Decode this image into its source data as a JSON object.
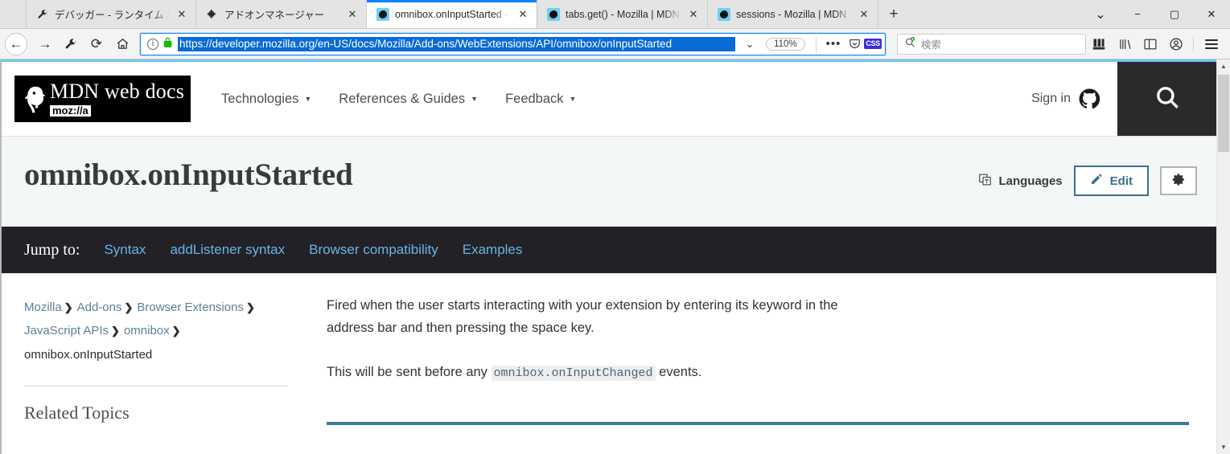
{
  "browser": {
    "tabs": [
      {
        "favicon": "wrench-icon",
        "title": "デバッガー - ランタイム / this-firefox",
        "active": false
      },
      {
        "favicon": "puzzle-icon",
        "title": "アドオンマネージャー",
        "active": false
      },
      {
        "favicon": "firefox-icon",
        "title": "omnibox.onInputStarted - Moz",
        "active": true
      },
      {
        "favicon": "firefox-icon",
        "title": "tabs.get() - Mozilla | MDN",
        "active": false
      },
      {
        "favicon": "firefox-icon",
        "title": "sessions - Mozilla | MDN",
        "active": false
      }
    ],
    "new_tab_label": "+",
    "close_label": "✕",
    "tab_list_label": "⌄",
    "window_controls": {
      "minimize": "−",
      "maximize": "▢",
      "close": "✕"
    },
    "nav": {
      "back_label": "←",
      "forward_label": "→",
      "devtools_label": "🔧",
      "reload_label": "⟳",
      "home_label": "⌂"
    },
    "urlbar": {
      "info_label": "i",
      "lock_label": "lock-icon",
      "url": "https://developer.mozilla.org/en-US/docs/Mozilla/Add-ons/WebExtensions/API/omnibox/onInputStarted",
      "dropdown_label": "⌄",
      "zoom_level": "110%",
      "page_actions_label": "•••",
      "pocket_label": "pocket-icon",
      "extension_badge": "CSS"
    },
    "search": {
      "placeholder": "検索",
      "icon": "search-add-icon"
    },
    "toolbar_icons": [
      "library-icon",
      "bookmarks-icon",
      "sidebar-icon",
      "account-icon",
      "menu-icon"
    ]
  },
  "mdn": {
    "logo": {
      "title": "MDN web docs",
      "sub": "moz://a"
    },
    "nav": [
      {
        "label": "Technologies"
      },
      {
        "label": "References & Guides"
      },
      {
        "label": "Feedback"
      }
    ],
    "signin_label": "Sign in",
    "search_button_label": "search-icon"
  },
  "page": {
    "title": "omnibox.onInputStarted",
    "languages_label": "Languages",
    "edit_label": "Edit",
    "settings_label": "gear-icon",
    "jump_to": {
      "label": "Jump to:",
      "links": [
        "Syntax",
        "addListener syntax",
        "Browser compatibility",
        "Examples"
      ]
    },
    "breadcrumbs": [
      {
        "label": "Mozilla",
        "link": true
      },
      {
        "label": "Add-ons",
        "link": true
      },
      {
        "label": "Browser Extensions",
        "link": true
      },
      {
        "label": "JavaScript APIs",
        "link": true
      },
      {
        "label": "omnibox",
        "link": true
      },
      {
        "label": "omnibox.onInputStarted",
        "link": false
      }
    ],
    "breadcrumb_separator": "❯",
    "related_topics_heading": "Related Topics",
    "paragraphs": {
      "p1": "Fired when the user starts interacting with your extension by entering its keyword in the address bar and then pressing the space key.",
      "p2_before": "This will be sent before any ",
      "p2_code": "omnibox.onInputChanged",
      "p2_after": " events."
    }
  },
  "colors": {
    "accent_blue": "#0a84ff",
    "mdn_link": "#6ab3e8",
    "teal": "#39718c",
    "hr": "#3d7e96",
    "jumpbar_bg": "#222226",
    "title_bg": "#f4f7f8"
  }
}
